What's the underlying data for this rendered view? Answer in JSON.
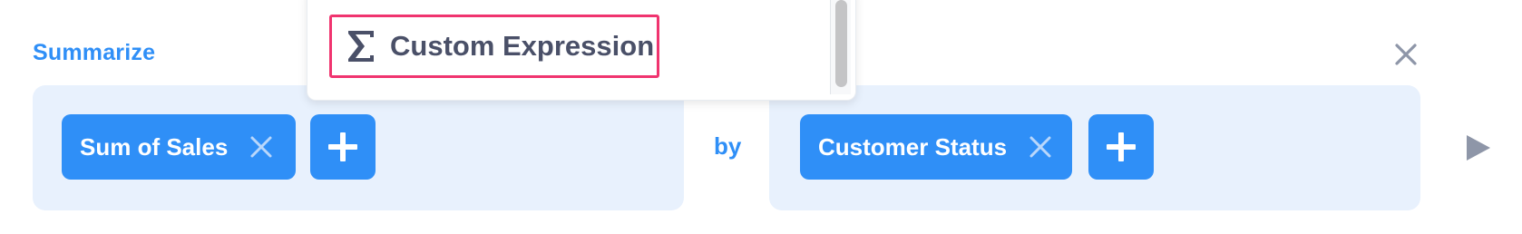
{
  "summarize": {
    "title": "Summarize",
    "metric_pill": "Sum of Sales",
    "by_label": "by",
    "group_pill": "Customer Status"
  },
  "dropdown": {
    "item_label": "Custom Expression",
    "item_icon": "sigma-icon"
  },
  "icons": {
    "close": "close-icon",
    "remove": "close-icon",
    "add": "plus-icon",
    "run": "play-icon"
  },
  "colors": {
    "accent": "#2f8ff7",
    "panel_bg": "#e8f1fd",
    "highlight": "#f0346f",
    "text_dark": "#4a5068",
    "muted_icon": "#8e96a8"
  }
}
